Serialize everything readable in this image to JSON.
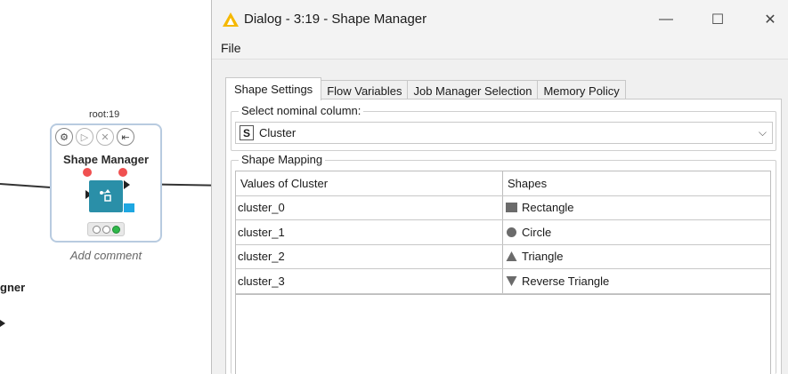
{
  "canvas": {
    "node_id": "root:19",
    "node_title": "Shape Manager",
    "add_comment": "Add comment",
    "partial_node_label": "gner",
    "colors": {
      "node_icon": "#2a8fa8",
      "port": "#f05050",
      "status_ok": "#2fb84a"
    }
  },
  "dialog": {
    "title": "Dialog - 3:19 - Shape Manager",
    "menu": {
      "file": "File"
    },
    "tabs": [
      {
        "label": "Shape Settings",
        "active": true
      },
      {
        "label": "Flow Variables",
        "active": false
      },
      {
        "label": "Job Manager Selection",
        "active": false
      },
      {
        "label": "Memory Policy",
        "active": false
      }
    ],
    "nominal_column": {
      "group_label": "Select nominal column:",
      "type_badge": "S",
      "selected": "Cluster"
    },
    "mapping": {
      "group_label": "Shape Mapping",
      "headers": [
        "Values of Cluster",
        "Shapes"
      ],
      "rows": [
        {
          "value": "cluster_0",
          "shape": "Rectangle",
          "icon": "rectangle-icon"
        },
        {
          "value": "cluster_1",
          "shape": "Circle",
          "icon": "circle-icon"
        },
        {
          "value": "cluster_2",
          "shape": "Triangle",
          "icon": "triangle-icon"
        },
        {
          "value": "cluster_3",
          "shape": "Reverse Triangle",
          "icon": "reverse-triangle-icon"
        }
      ]
    }
  }
}
